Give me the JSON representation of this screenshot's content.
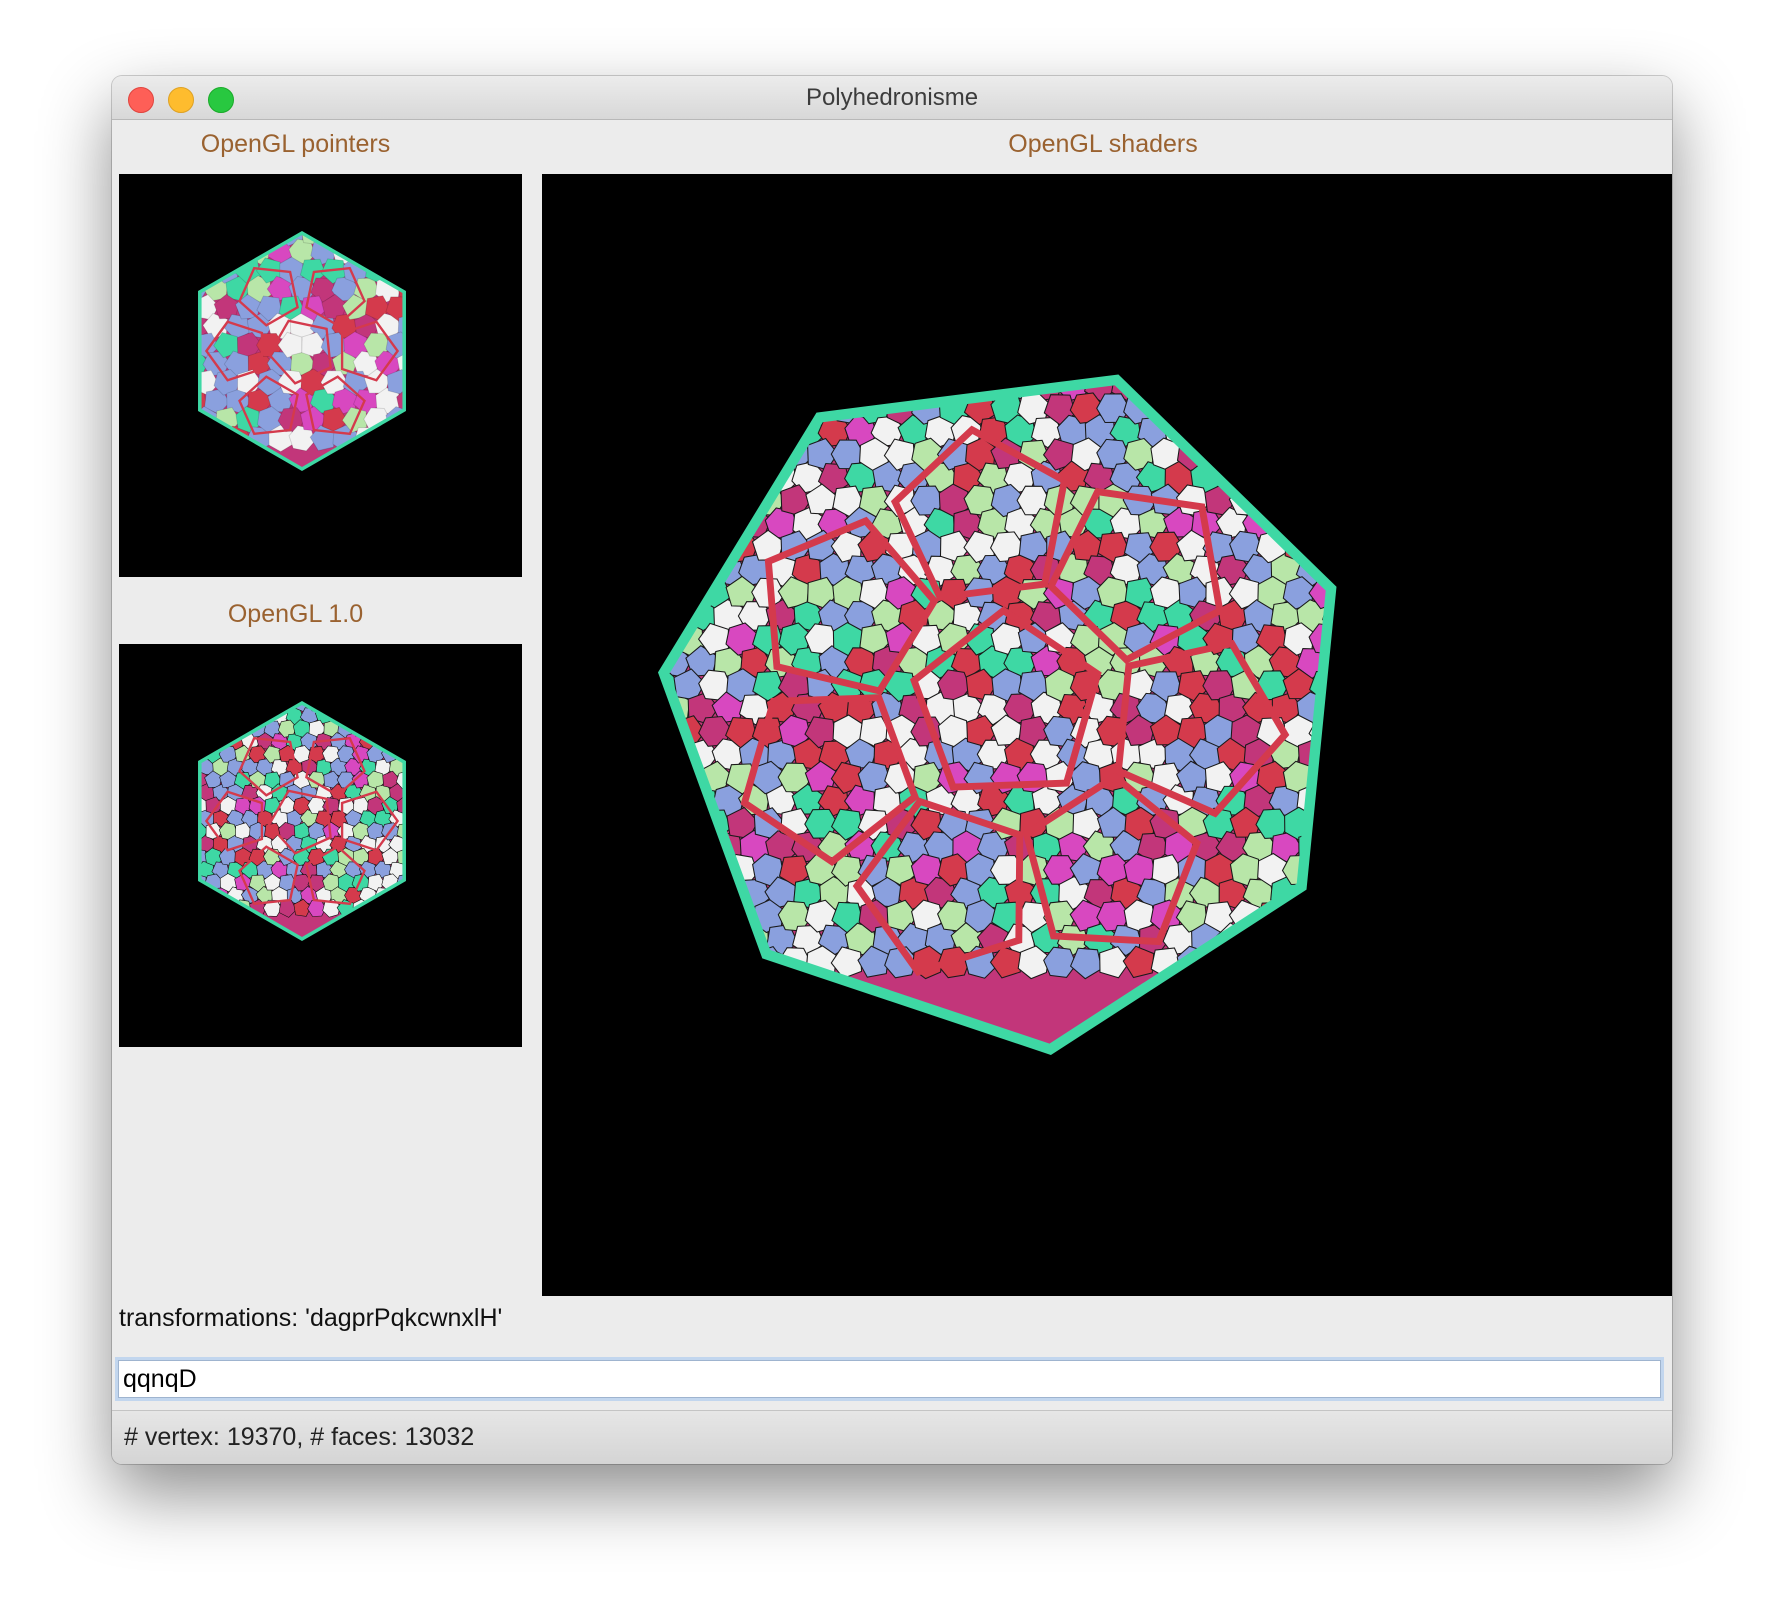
{
  "window": {
    "title": "Polyhedronisme"
  },
  "panels": {
    "pointers_label": "OpenGL pointers",
    "gl10_label": "OpenGL 1.0",
    "shaders_label": "OpenGL shaders"
  },
  "transformations_text": "transformations: 'dagprPqkcwnxlH'",
  "command_input": {
    "value": "qqnqD"
  },
  "status": {
    "text": "# vertex: 19370, # faces: 13032"
  },
  "colors": {
    "label_brown": "#9a6230",
    "canvas_background": "#000000",
    "mint": "#3ed8a4",
    "crimson": "#d43a4c",
    "rose": "#c2367a",
    "magenta": "#d848c0",
    "periwinkle": "#8aa0de",
    "pale_green": "#b8e6a8",
    "white": "#f2f2f2"
  }
}
